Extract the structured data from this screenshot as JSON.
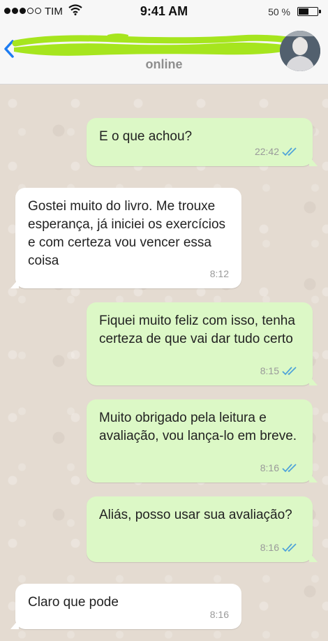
{
  "status_bar": {
    "carrier": "TIM",
    "time": "9:41 AM",
    "battery_percent": "50 %",
    "battery_level": 0.5
  },
  "header": {
    "contact_status": "online"
  },
  "colors": {
    "outgoing_bubble": "#dcf8c6",
    "incoming_bubble": "#ffffff",
    "read_ticks": "#4fa3d9",
    "back_arrow": "#1d7cf2",
    "redaction": "#a6e51e"
  },
  "messages": [
    {
      "direction": "out",
      "text": "E o que achou?",
      "time": "22:42",
      "status": "read"
    },
    {
      "direction": "in",
      "text": "Gostei muito do livro. Me trouxe esperança, já iniciei os exercícios e com certeza vou vencer essa coisa",
      "time": "8:12"
    },
    {
      "direction": "out",
      "text": "Fiquei muito feliz com isso, tenha certeza de que vai dar tudo certo",
      "time": "8:15",
      "status": "read"
    },
    {
      "direction": "out",
      "text": "Muito obrigado pela leitura e avaliação, vou lança-lo em breve.",
      "time": "8:16",
      "status": "read"
    },
    {
      "direction": "out",
      "text": "Aliás, posso usar sua avaliação?",
      "time": "8:16",
      "status": "read"
    },
    {
      "direction": "in",
      "text": "Claro que pode",
      "time": "8:16"
    }
  ]
}
